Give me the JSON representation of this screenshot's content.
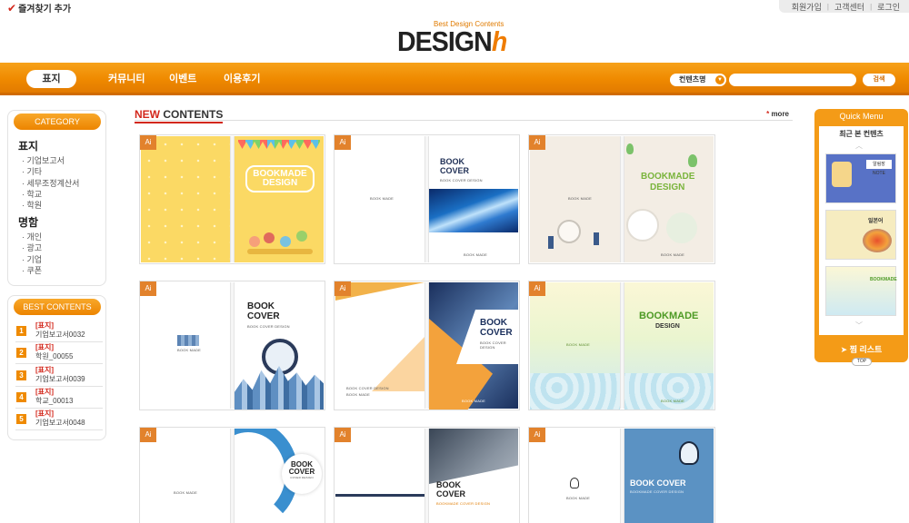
{
  "topbar": {
    "favorite": "즐겨찾기 추가",
    "links": [
      "회원가입",
      "고객센터",
      "로그인"
    ]
  },
  "logo": {
    "tagline": "Best Design Contents",
    "word": "DESIGN",
    "h": "h"
  },
  "nav": {
    "tabs": [
      "표지",
      "커뮤니티",
      "이벤트",
      "이용후기"
    ],
    "search_select": "컨텐츠명",
    "search_placeholder": "",
    "search_button": "검색"
  },
  "category": {
    "title": "CATEGORY",
    "groups": [
      {
        "title": "표지",
        "items": [
          "· 기업보고서",
          "· 기타",
          "· 세무조정계산서",
          "· 학교",
          "· 학원"
        ]
      },
      {
        "title": "명함",
        "items": [
          "· 개인",
          "· 광고",
          "· 기업",
          "· 쿠폰"
        ]
      }
    ]
  },
  "best": {
    "title": "BEST CONTENTS",
    "items": [
      {
        "num": "1",
        "category": "[표지]",
        "name": "기업보고서0032"
      },
      {
        "num": "2",
        "category": "[표지]",
        "name": "학원_00055"
      },
      {
        "num": "3",
        "category": "[표지]",
        "name": "기업보고서0039"
      },
      {
        "num": "4",
        "category": "[표지]",
        "name": "학교_00013"
      },
      {
        "num": "5",
        "category": "[표지]",
        "name": "기업보고서0048"
      }
    ]
  },
  "main": {
    "heading_new": "NEW",
    "heading_rest": " CONTENTS",
    "more": "more",
    "badge": "Ai",
    "texts": {
      "bookmade_design_1": "BOOKMADE",
      "bookmade_design_2": "DESIGN",
      "book": "BOOK",
      "cover": "COVER",
      "book_cover": "BOOK COVER",
      "cover_design": "BOOK COVER DESIGN",
      "cover_design_small": "COVER DESIGN",
      "bookmade_small": "BOOK MADE",
      "bookmade_cover_design": "BOOKMADE COVER DESIGN"
    }
  },
  "quick_menu": {
    "title": "Quick Menu",
    "recent": "최근 본 컨텐츠",
    "wishlist": "찜 리스트",
    "top": "TOP",
    "thumb_texts": [
      "알림장",
      "일본어"
    ]
  },
  "colors": {
    "accent": "#ef8a00",
    "red": "#d3281c",
    "badge": "#e2822c"
  }
}
